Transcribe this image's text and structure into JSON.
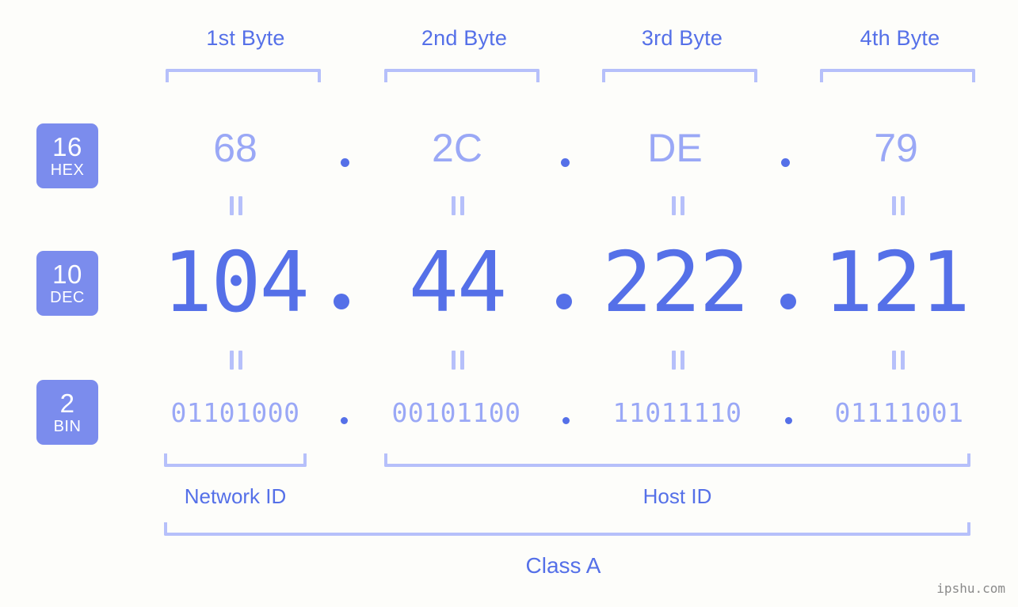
{
  "background_color": "#fdfdfa",
  "colors": {
    "badge_background": "#7b8ced",
    "badge_text": "#ffffff",
    "accent_strong": "#5570e8",
    "accent_light": "#9aa8f6",
    "bracket": "#b6c0fa",
    "watermark": "#8a8a8a"
  },
  "byte_headers": [
    {
      "label": "1st Byte"
    },
    {
      "label": "2nd Byte"
    },
    {
      "label": "3rd Byte"
    },
    {
      "label": "4th Byte"
    }
  ],
  "rows": {
    "hex": {
      "badge_number": "16",
      "badge_system": "HEX",
      "values": [
        "68",
        "2C",
        "DE",
        "79"
      ],
      "separator": "."
    },
    "dec": {
      "badge_number": "10",
      "badge_system": "DEC",
      "values": [
        "104",
        "44",
        "222",
        "121"
      ],
      "separator": "."
    },
    "bin": {
      "badge_number": "2",
      "badge_system": "BIN",
      "values": [
        "01101000",
        "00101100",
        "11011110",
        "01111001"
      ],
      "separator": "."
    }
  },
  "equality_symbol": "||",
  "sections": {
    "network_id": "Network ID",
    "host_id": "Host ID"
  },
  "class_label": "Class A",
  "watermark": "ipshu.com"
}
